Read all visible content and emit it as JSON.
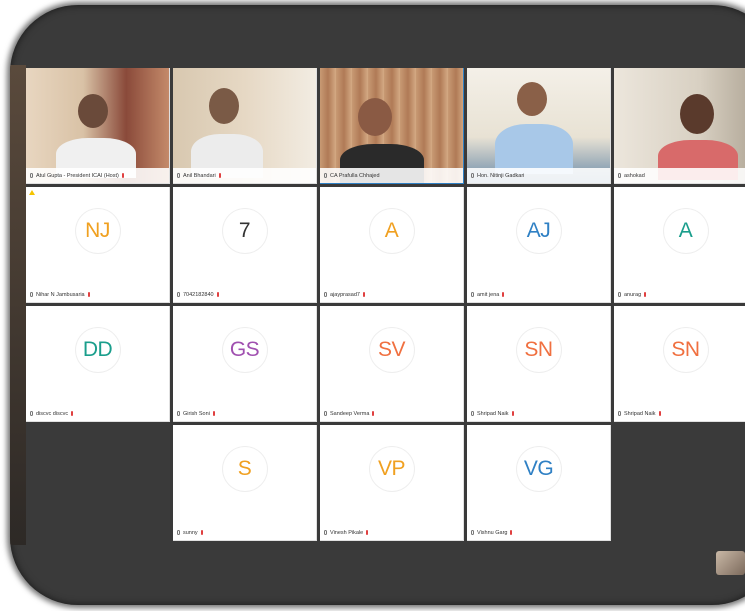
{
  "participants": [
    {
      "name": "Atul Gupta - President ICAI (Host)",
      "type": "video"
    },
    {
      "name": "Anil Bhandari",
      "type": "video"
    },
    {
      "name": "CA Prafulla Chhajed",
      "type": "video",
      "active": true
    },
    {
      "name": "Hon. Nitinji Gadkari",
      "type": "video"
    },
    {
      "name": "ashokad",
      "type": "video"
    },
    {
      "name": "Nihar N Jambusaria",
      "initials": "NJ",
      "color": "#f0a020",
      "type": "avatar",
      "raised_hand": true
    },
    {
      "name": "7042182840",
      "initials": "7",
      "color": "#333333",
      "type": "avatar"
    },
    {
      "name": "ajayprasad7",
      "initials": "A",
      "color": "#f0a020",
      "type": "avatar"
    },
    {
      "name": "amit jena",
      "initials": "AJ",
      "color": "#2f80c4",
      "type": "avatar"
    },
    {
      "name": "anurag",
      "initials": "A",
      "color": "#1a9e8c",
      "type": "avatar"
    },
    {
      "name": "discvc discvc",
      "initials": "DD",
      "color": "#1a9e8c",
      "type": "avatar"
    },
    {
      "name": "Girish Soni",
      "initials": "GS",
      "color": "#a050b0",
      "type": "avatar"
    },
    {
      "name": "Sandeep Verma",
      "initials": "SV",
      "color": "#f07040",
      "type": "avatar"
    },
    {
      "name": "Shripad Naik",
      "initials": "SN",
      "color": "#f07040",
      "type": "avatar"
    },
    {
      "name": "Shripad Naik",
      "initials": "SN",
      "color": "#f07040",
      "type": "avatar"
    },
    {
      "name": "sunny",
      "initials": "S",
      "color": "#f0a020",
      "type": "avatar"
    },
    {
      "name": "Vinesh Pikale",
      "initials": "VP",
      "color": "#f0a020",
      "type": "avatar"
    },
    {
      "name": "Vishnu Garg",
      "initials": "VG",
      "color": "#2f80c4",
      "type": "avatar"
    }
  ]
}
